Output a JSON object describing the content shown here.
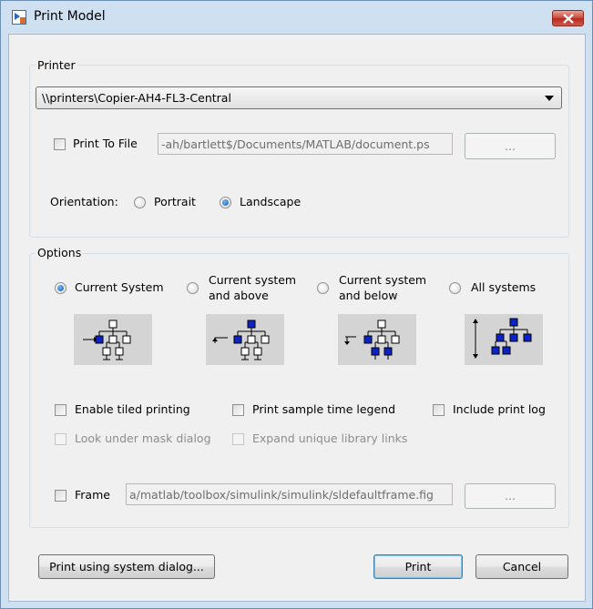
{
  "window": {
    "title": "Print Model"
  },
  "printer": {
    "group_label": "Printer",
    "selected_printer": "\\\\printers\\Copier-AH4-FL3-Central",
    "print_to_file_label": "Print To File",
    "print_to_file_checked": false,
    "file_path": "-ah/bartlett$/Documents/MATLAB/document.ps",
    "browse_label": "...",
    "orientation_label": "Orientation:",
    "portrait_label": "Portrait",
    "landscape_label": "Landscape",
    "orientation_selected": "Landscape"
  },
  "options": {
    "group_label": "Options",
    "scope": [
      {
        "label_line1": "Current System",
        "label_line2": "",
        "checked": true,
        "icon": "current-system-tree-icon"
      },
      {
        "label_line1": "Current system",
        "label_line2": "and above",
        "checked": false,
        "icon": "system-and-above-tree-icon"
      },
      {
        "label_line1": "Current system",
        "label_line2": "and below",
        "checked": false,
        "icon": "system-and-below-tree-icon"
      },
      {
        "label_line1": "All systems",
        "label_line2": "",
        "checked": false,
        "icon": "all-systems-tree-icon"
      }
    ],
    "enable_tiled": "Enable tiled printing",
    "sample_time_legend": "Print sample time legend",
    "include_print_log": "Include print log",
    "look_under_mask": "Look under mask dialog",
    "expand_library_links": "Expand unique library links",
    "frame_label": "Frame",
    "frame_path": "a/matlab/toolbox/simulink/simulink/sldefaultframe.fig",
    "frame_browse_label": "..."
  },
  "buttons": {
    "system_dialog": "Print using system dialog...",
    "print": "Print",
    "cancel": "Cancel"
  },
  "colors": {
    "accent_blue": "#0b23c8",
    "close_red": "#c8493a"
  }
}
